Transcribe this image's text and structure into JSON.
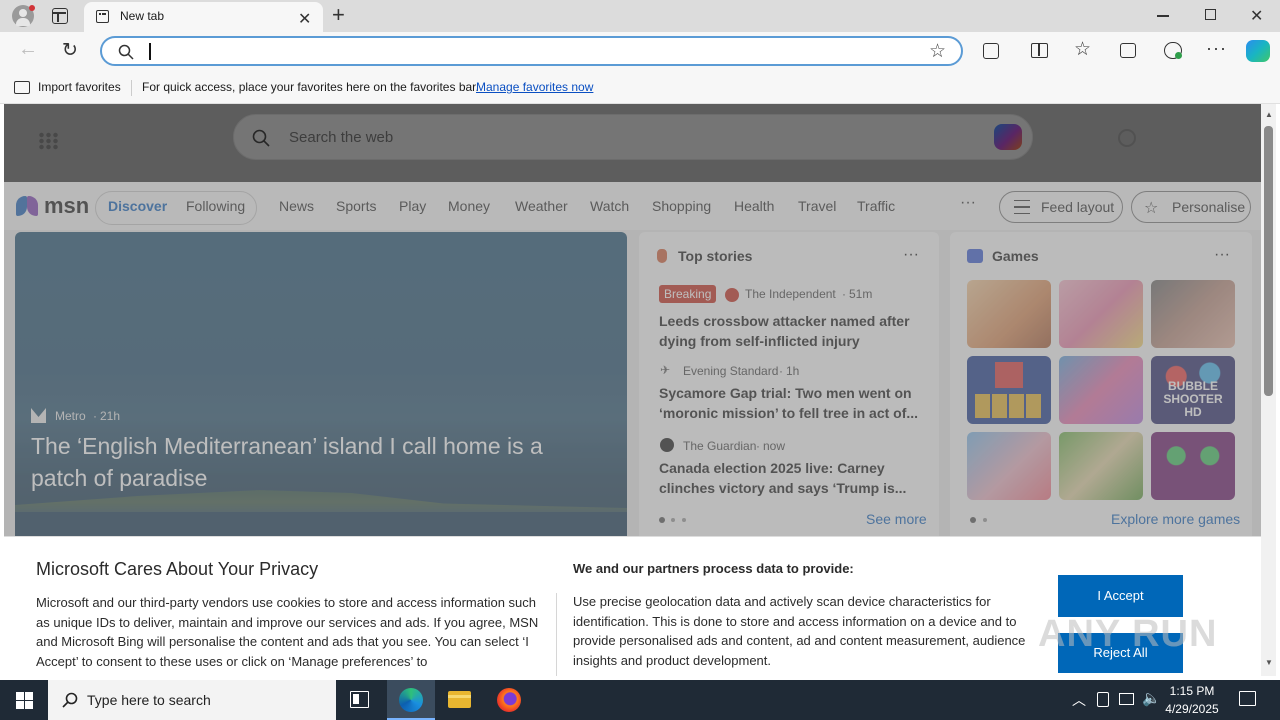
{
  "browser": {
    "tab_title": "New tab",
    "address_value": "",
    "favorites_bar": {
      "import_label": "Import favorites",
      "hint_text": "For quick access, place your favorites here on the favorites bar.",
      "manage_link": "Manage favorites now"
    }
  },
  "newtab": {
    "search_placeholder": "Search the web",
    "msn": {
      "logo_text": "msn",
      "tabs": [
        "Discover",
        "Following"
      ],
      "nav_items": [
        "News",
        "Sports",
        "Play",
        "Money",
        "Weather",
        "Watch",
        "Shopping",
        "Health",
        "Travel",
        "Traffic"
      ],
      "more_label": "···",
      "feed_layout_label": "Feed layout",
      "personalise_label": "Personalise"
    },
    "hero": {
      "source": "Metro",
      "age": "21h",
      "title": "The ‘English Mediterranean’ island I call home is a patch of paradise"
    },
    "top_stories": {
      "heading": "Top stories",
      "more": "···",
      "see_more": "See more",
      "items": [
        {
          "badge": "Breaking",
          "source": "The Independent",
          "age": "51m",
          "title": "Leeds crossbow attacker named after dying from self-inflicted injury"
        },
        {
          "badge": "",
          "source": "Evening Standard",
          "age": "1h",
          "title": "Sycamore Gap trial: Two men went on ‘moronic mission’ to fell tree in act of..."
        },
        {
          "badge": "",
          "source": "The Guardian",
          "age": "now",
          "title": "Canada election 2025 live: Carney clinches victory and says ‘Trump is..."
        }
      ]
    },
    "games": {
      "heading": "Games",
      "more": "···",
      "explore": "Explore more games",
      "bubble_logo": "BUBBLE SHOOTER HD"
    }
  },
  "privacy": {
    "title": "Microsoft Cares About Your Privacy",
    "body": "Microsoft and our third-party vendors use cookies to store and access information such as unique IDs to deliver, maintain and improve our services and ads. If you agree, MSN and Microsoft Bing will personalise the content and ads that you see. You can select ‘I Accept’ to consent to these uses or click on ‘Manage preferences’ to",
    "partners_title": "We and our partners process data to provide:",
    "partners_body": "Use precise geolocation data and actively scan device characteristics for identification. This is done to store and access information on a device and to provide personalised ads and content, ad and content measurement, audience insights and product development.",
    "accept_label": "I Accept",
    "reject_label": "Reject All"
  },
  "watermark": "ANY RUN",
  "taskbar": {
    "search_placeholder": "Type here to search",
    "time": "1:15 PM",
    "date": "4/29/2025"
  },
  "colors": {
    "accent": "#0067b8",
    "breaking": "#c42b1c",
    "taskbar": "#1f2a36"
  }
}
